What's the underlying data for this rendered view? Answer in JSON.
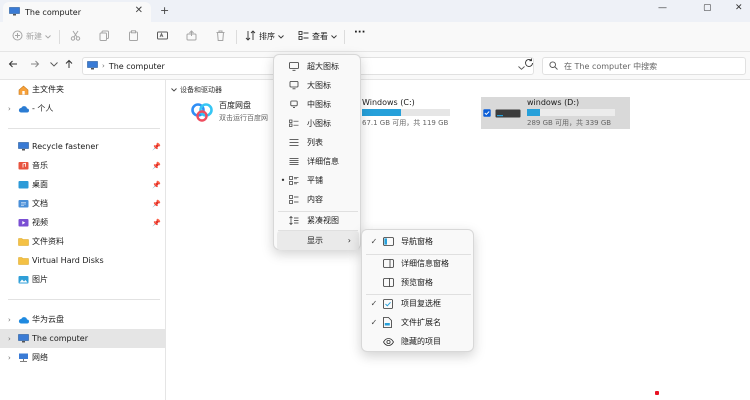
{
  "window": {
    "tab_title": "The computer",
    "close_glyph": "✕",
    "new_tab_glyph": "+",
    "min_glyph": "—",
    "max_glyph": "▢",
    "close_window_glyph": "✕"
  },
  "toolbar": {
    "new_label": "新建",
    "sort_label": "排序",
    "view_label": "查看",
    "more_glyph": "···"
  },
  "address": {
    "path": "The computer",
    "search_placeholder": "在 The computer 中搜索"
  },
  "sidebar": {
    "items": [
      {
        "label": "主文件夹"
      },
      {
        "label": "- 个人"
      },
      {
        "label": "Recycle fastener"
      },
      {
        "label": "音乐"
      },
      {
        "label": "桌面"
      },
      {
        "label": "文档"
      },
      {
        "label": "视频"
      },
      {
        "label": "文件资料"
      },
      {
        "label": "Virtual Hard Disks"
      },
      {
        "label": "图片"
      },
      {
        "label": "华为云盘"
      },
      {
        "label": "The computer"
      },
      {
        "label": "网络"
      }
    ]
  },
  "content": {
    "group_label": "设备和驱动器",
    "drives": [
      {
        "name": "百度网盘",
        "sub": "双击运行百度网"
      },
      {
        "name": "Windows (C:)",
        "sub": "67.1 GB 可用，共 119 GB",
        "used_fraction": 0.44
      },
      {
        "name": "windows (D:)",
        "sub": "289 GB 可用，共 339 GB",
        "used_fraction": 0.15
      }
    ]
  },
  "view_menu": {
    "items": [
      {
        "label": "超大图标"
      },
      {
        "label": "大图标"
      },
      {
        "label": "中图标"
      },
      {
        "label": "小图标"
      },
      {
        "label": "列表"
      },
      {
        "label": "详细信息"
      },
      {
        "label": "平铺"
      },
      {
        "label": "内容"
      },
      {
        "label": "紧凑视图"
      },
      {
        "label": "显示"
      }
    ],
    "selected_bullet": "•",
    "submenu_arrow": "›"
  },
  "show_submenu": {
    "items": [
      {
        "label": "导航窗格"
      },
      {
        "label": "详细信息窗格"
      },
      {
        "label": "预览窗格"
      },
      {
        "label": "项目复选框"
      },
      {
        "label": "文件扩展名"
      },
      {
        "label": "隐藏的项目"
      }
    ],
    "check_glyph": "✓"
  },
  "colors": {
    "accent": "#26a0da",
    "folder": "#f4c145",
    "selection": "#cce8ff"
  }
}
